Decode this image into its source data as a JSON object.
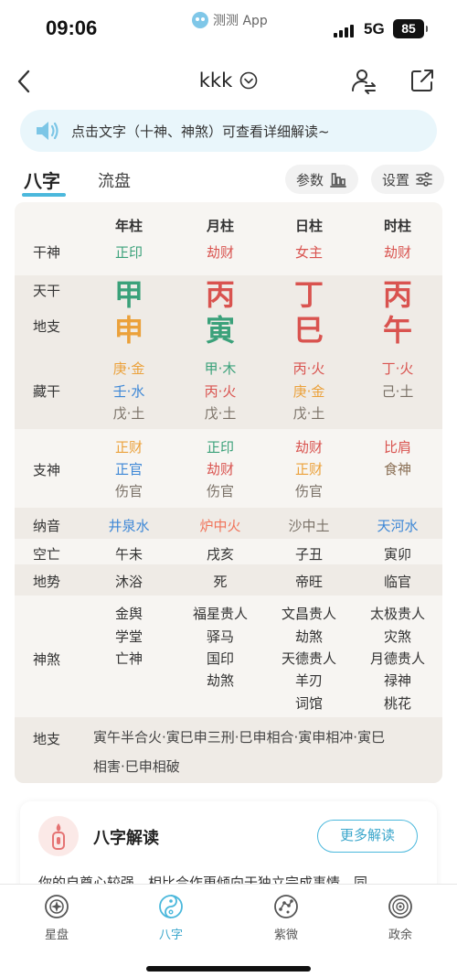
{
  "status_bar": {
    "time": "09:06",
    "app": "测测 App",
    "network": "5G",
    "battery": "85"
  },
  "nav": {
    "title": "kkk"
  },
  "tip": {
    "text": "点击文字（十神、神煞）可查看详细解读~"
  },
  "tabs": {
    "bazi": "八字",
    "liupan": "流盘",
    "params": "参数",
    "settings": "设置"
  },
  "chart": {
    "headers": [
      "年柱",
      "月柱",
      "日柱",
      "时柱"
    ],
    "labels": {
      "shishen": "干神",
      "tiangan": "天干",
      "dizhi": "地支",
      "canggan": "藏干",
      "zhishen": "支神",
      "nayin": "纳音",
      "kongwang": "空亡",
      "dishi": "地势",
      "shensha": "神煞",
      "dizhi_rel": "地支"
    },
    "shishen": [
      "正印",
      "劫财",
      "女主",
      "劫财"
    ],
    "tiangan": [
      "甲",
      "丙",
      "丁",
      "丙"
    ],
    "dizhi": [
      "申",
      "寅",
      "巳",
      "午"
    ],
    "canggan": [
      [
        "庚·金",
        "壬·水",
        "戊·土"
      ],
      [
        "甲·木",
        "丙·火",
        "戊·土"
      ],
      [
        "丙·火",
        "庚·金",
        "戊·土"
      ],
      [
        "丁·火",
        "己·土"
      ]
    ],
    "zhishen": [
      [
        "正财",
        "正官",
        "伤官"
      ],
      [
        "正印",
        "劫财",
        "伤官"
      ],
      [
        "劫财",
        "正财",
        "伤官"
      ],
      [
        "比肩",
        "食神"
      ]
    ],
    "nayin": [
      "井泉水",
      "炉中火",
      "沙中土",
      "天河水"
    ],
    "kongwang": [
      "午未",
      "戌亥",
      "子丑",
      "寅卯"
    ],
    "dishi": [
      "沐浴",
      "死",
      "帝旺",
      "临官"
    ],
    "shensha": [
      [
        "金舆",
        "学堂",
        "亡神"
      ],
      [
        "福星贵人",
        "驿马",
        "国印",
        "劫煞"
      ],
      [
        "文昌贵人",
        "劫煞",
        "天德贵人",
        "羊刃",
        "词馆"
      ],
      [
        "太极贵人",
        "灾煞",
        "月德贵人",
        "禄神",
        "桃花"
      ]
    ],
    "dizhi_relations": [
      "寅午半合火·寅巳申三刑·巳申相合·寅申相冲·寅巳",
      "相害·巳申相破"
    ]
  },
  "interpretation": {
    "title": "八字解读",
    "more": "更多解读",
    "body": "你的自尊心较强，相比合作更倾向于独立完成事情，同"
  },
  "bottom_nav": {
    "items": [
      "星盘",
      "八字",
      "紫微",
      "政余"
    ],
    "active_index": 1
  },
  "colors": {
    "accent": "#4bb8dc",
    "red": "#d9534f",
    "green": "#3ba17a",
    "orange": "#eba13b",
    "blue": "#3d87d6",
    "gray": "#7a7167",
    "chart_bg": "#f7f5f2",
    "chart_band": "#efebe6"
  }
}
